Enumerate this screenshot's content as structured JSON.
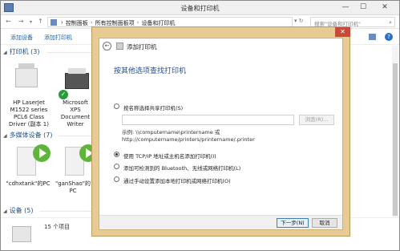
{
  "window": {
    "title": "设备和打印机",
    "controls": {
      "minimize": "—",
      "maximize": "☐",
      "close": "✕"
    }
  },
  "address": {
    "nav": {
      "back": "←",
      "forward": "→",
      "dropdown": "▾",
      "up": "↑"
    },
    "crumbs": [
      "控制面板",
      "所有控制面板项",
      "设备和打印机"
    ],
    "separator": "›",
    "controls": "▾ ↻",
    "search_placeholder": "搜索\"设备和打印机\"",
    "search_glyph": "⌕"
  },
  "commands": {
    "add_device": "添加设备",
    "add_printer": "添加打印机",
    "view_glyph": "▾",
    "help_glyph": "?"
  },
  "sections": {
    "printers": "打印机 (3)",
    "media": "多媒体设备 (7)",
    "devices": "设备 (5)",
    "chevron": "◢"
  },
  "printers": [
    {
      "label": "HP LaserJet M1522 series PCL6 Class Driver (副本 1)"
    },
    {
      "label": "Microsoft XPS Document Writer"
    }
  ],
  "default_mark": "✓",
  "media": [
    {
      "label": "\"cdhxtank\"的PC"
    },
    {
      "label": "\"ganShao\"的PC"
    }
  ],
  "status": {
    "count": "15 个项目"
  },
  "dialog": {
    "close": "✕",
    "back_glyph": "←",
    "title": "添加打印机",
    "heading": "按其他选项查找打印机",
    "options": [
      {
        "label": "按名称选择共享打印机(S)",
        "selected": false
      },
      {
        "label": "使用 TCP/IP 地址或主机名添加打印机(I)",
        "selected": true
      },
      {
        "label": "添加可检测到的 Bluetooth、无线或网络打印机(L)",
        "selected": false
      },
      {
        "label": "通过手动设置添加本地打印机或网络打印机(O)",
        "selected": false
      }
    ],
    "browse": "浏览(R)...",
    "example_line1": "示例: \\\\computername\\printername 或",
    "example_line2": "http://computername/printers/printername/.printer",
    "next": "下一步(N)",
    "cancel": "取消"
  }
}
